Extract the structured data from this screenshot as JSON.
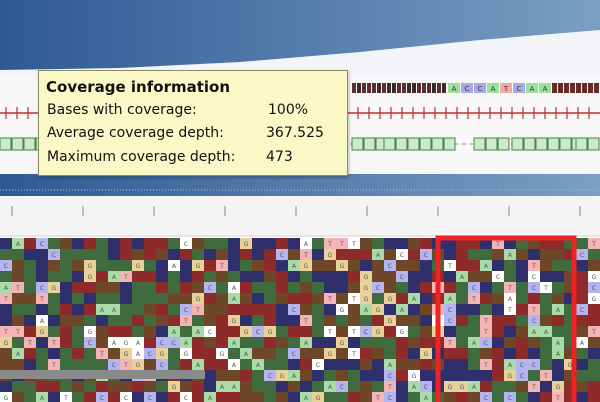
{
  "tooltip": {
    "title": "Coverage information",
    "rows": [
      {
        "label": "Bases with coverage:",
        "value": "100%"
      },
      {
        "label": "Average coverage depth:",
        "value": "367.525"
      },
      {
        "label": "Maximum coverage depth:",
        "value": "473"
      }
    ]
  },
  "colors": {
    "sky_dark": "#2e5a93",
    "sky_light": "#7b9fc4",
    "base_A": "#3f6b3f",
    "base_C": "#2f2f6b",
    "base_G": "#6e4628",
    "base_T": "#8d2b2b",
    "highlight": "#ee2222",
    "tooltip_bg": "#fbf8c8"
  },
  "reference_strip": [
    "A",
    "C",
    "C",
    "A",
    "T",
    "C",
    "A",
    "A"
  ],
  "highlight_box": {
    "label": ""
  }
}
